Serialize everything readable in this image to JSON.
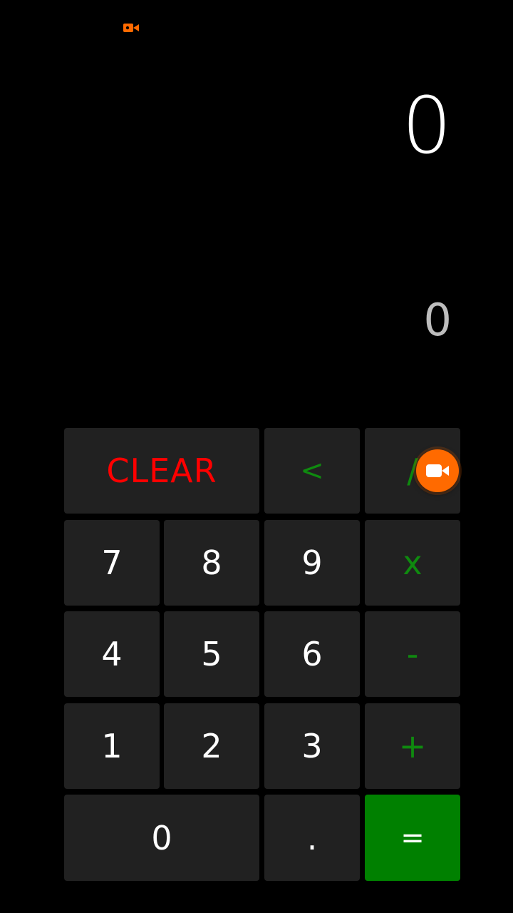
{
  "status_bar": {
    "record_icon": "video-record-icon",
    "record_icon_color": "#ff6a00"
  },
  "display": {
    "result": "0",
    "expression": "0"
  },
  "keypad": {
    "clear": "CLEAR",
    "backspace": "<",
    "divide": "/",
    "multiply": "x",
    "minus": "-",
    "plus": "+",
    "equals": "=",
    "decimal": ".",
    "digits": [
      "0",
      "1",
      "2",
      "3",
      "4",
      "5",
      "6",
      "7",
      "8",
      "9"
    ]
  },
  "colors": {
    "background": "#000000",
    "key_background": "#212121",
    "operator": "#0f8a0f",
    "clear": "#ff0000",
    "equals_background": "#008000",
    "fab": "#ff6a00"
  },
  "floating_button": {
    "icon": "video-camera-icon"
  }
}
